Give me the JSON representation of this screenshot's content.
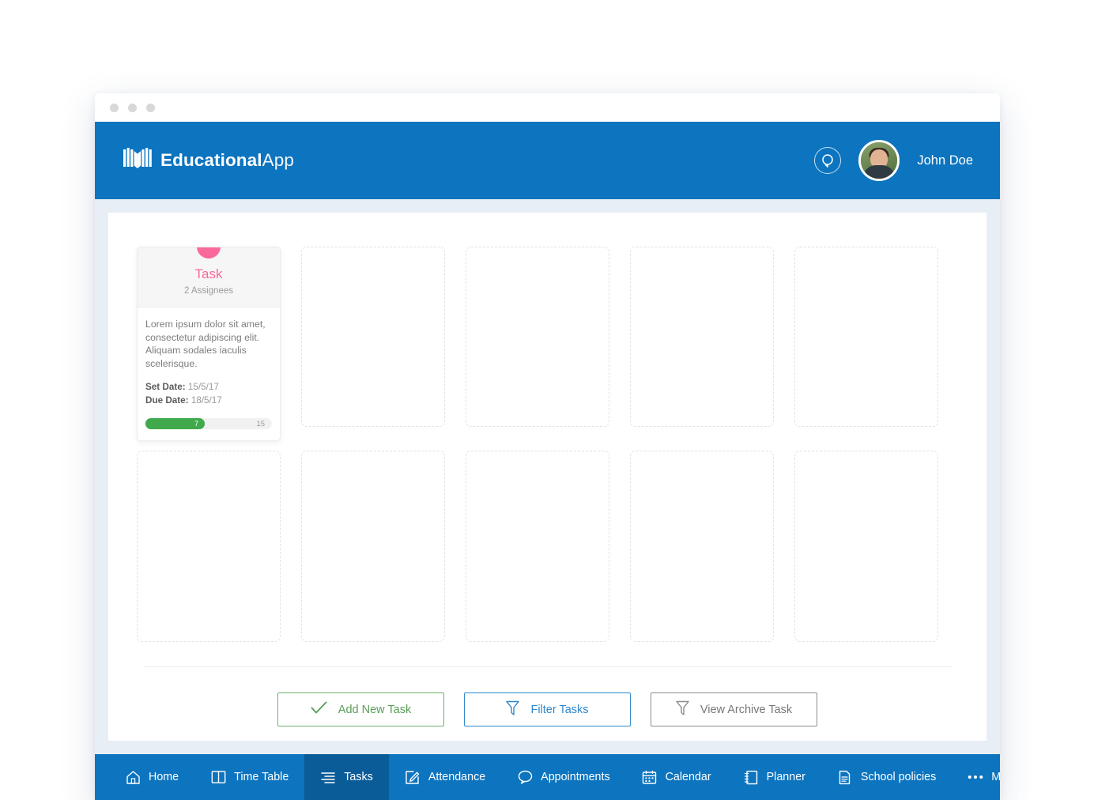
{
  "window": {
    "dots": [
      "window-dot",
      "window-dot",
      "window-dot"
    ]
  },
  "header": {
    "brand_bold": "Educational",
    "brand_light": "App",
    "logo_icon": "open-book-icon",
    "help_icon": "support-circle-icon",
    "avatar_icon": "user-avatar",
    "username": "John Doe",
    "background_color": "#0d74bf"
  },
  "task_card": {
    "badge_icon": "pink-circle-badge",
    "badge_color": "#f9699b",
    "title": "Task",
    "assignees": "2 Assignees",
    "description": "Lorem ipsum dolor sit amet, consectetur adipiscing elit. Aliquam sodales iaculis scelerisque.",
    "set_date_label": "Set Date:",
    "set_date_value": "15/5/17",
    "due_date_label": "Due Date:",
    "due_date_value": "18/5/17",
    "progress_value": "7",
    "progress_max": "15",
    "progress_percent": 47,
    "progress_color": "#3fa94b"
  },
  "placeholders": {
    "count": 9,
    "label": "empty-task-slot"
  },
  "actions": [
    {
      "label": "Add New Task",
      "icon": "check-icon",
      "color": "#5a9e59",
      "border": "#6cb06b",
      "name": "add-new-task-button"
    },
    {
      "label": "Filter Tasks",
      "icon": "funnel-icon",
      "color": "#2f87cc",
      "border": "#2f87cc",
      "name": "filter-tasks-button"
    },
    {
      "label": "View Archive Task",
      "icon": "funnel-icon",
      "color": "#777777",
      "border": "#8c8c8c",
      "name": "view-archive-task-button"
    }
  ],
  "bottom_nav": {
    "active": "Tasks",
    "items": [
      {
        "label": "Home",
        "icon": "home-icon"
      },
      {
        "label": "Time Table",
        "icon": "book-open-icon"
      },
      {
        "label": "Tasks",
        "icon": "list-icon"
      },
      {
        "label": "Attendance",
        "icon": "edit-square-icon"
      },
      {
        "label": "Appointments",
        "icon": "speech-bubble-icon"
      },
      {
        "label": "Calendar",
        "icon": "calendar-icon"
      },
      {
        "label": "Planner",
        "icon": "notebook-icon"
      },
      {
        "label": "School policies",
        "icon": "document-icon"
      },
      {
        "label": "More",
        "icon": "ellipsis-icon"
      }
    ]
  }
}
